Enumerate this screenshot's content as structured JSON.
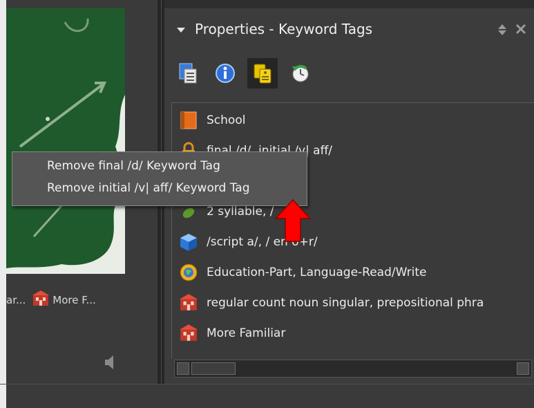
{
  "left_panel": {
    "caption_left": "ar...",
    "caption_right": "More F...",
    "caption_icon": "flashcard-icon",
    "speaker_icon": "speaker-icon"
  },
  "panel": {
    "title": "Properties - Keyword Tags",
    "toolbar": [
      {
        "icon": "document-list-icon"
      },
      {
        "icon": "info-icon"
      },
      {
        "icon": "keyword-tags-icon",
        "active": true
      },
      {
        "icon": "refresh-icon"
      }
    ]
  },
  "tags": [
    {
      "label": "School",
      "icon": "orange-book-icon"
    },
    {
      "label": "final /d/, initial /v| aff/",
      "icon": "lock-icon"
    },
    {
      "label": "",
      "icon": "hidden"
    },
    {
      "label": "2 syllable, /",
      "icon": "green-leaf-icon"
    },
    {
      "label": "/script a/, /  en o+r/",
      "icon": "blue-cube-icon"
    },
    {
      "label": "Education-Part, Language-Read/Write",
      "icon": "globe-icon"
    },
    {
      "label": "regular count noun singular, prepositional phra",
      "icon": "flashcard-icon"
    },
    {
      "label": "More Familiar",
      "icon": "flashcard-icon"
    }
  ],
  "context_menu": {
    "items": [
      {
        "label": "Remove final /d/ Keyword Tag"
      },
      {
        "label": "Remove initial /v| aff/ Keyword Tag"
      }
    ]
  },
  "colors": {
    "panel_bg": "#3c3c3c",
    "menu_bg": "#555555",
    "arrow": "#ff0000"
  }
}
